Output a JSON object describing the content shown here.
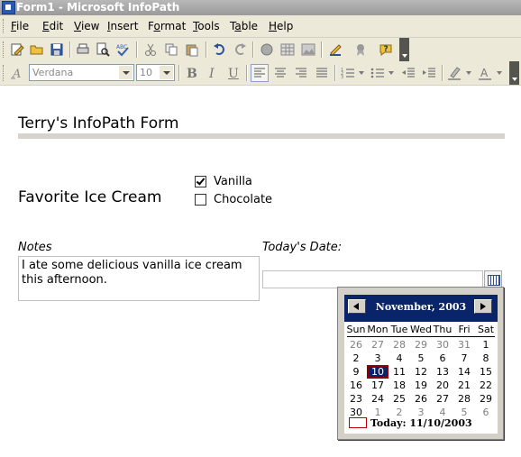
{
  "window": {
    "title": "Form1 - Microsoft InfoPath"
  },
  "menu": [
    {
      "label": "File",
      "mnemonic": "F"
    },
    {
      "label": "Edit",
      "mnemonic": "E"
    },
    {
      "label": "View",
      "mnemonic": "V"
    },
    {
      "label": "Insert",
      "mnemonic": "I"
    },
    {
      "label": "Format",
      "mnemonic": "o"
    },
    {
      "label": "Tools",
      "mnemonic": "T"
    },
    {
      "label": "Table",
      "mnemonic": "a"
    },
    {
      "label": "Help",
      "mnemonic": "H"
    }
  ],
  "format_toolbar": {
    "font_name": "Verdana",
    "font_size": "10",
    "bold": "B",
    "italic": "I",
    "underline": "U"
  },
  "form": {
    "title": "Terry's InfoPath Form",
    "favorite_label": "Favorite Ice Cream",
    "options": [
      {
        "label": "Vanilla",
        "checked": true
      },
      {
        "label": "Chocolate",
        "checked": false
      }
    ],
    "notes_label": "Notes",
    "notes_value": "I ate some delicious vanilla ice cream this afternoon.",
    "date_label": "Today's Date:",
    "date_value": ""
  },
  "calendar": {
    "month_label": "November, 2003",
    "weekdays": [
      "Sun",
      "Mon",
      "Tue",
      "Wed",
      "Thu",
      "Fri",
      "Sat"
    ],
    "weeks": [
      [
        "26",
        "27",
        "28",
        "29",
        "30",
        "31",
        "1"
      ],
      [
        "2",
        "3",
        "4",
        "5",
        "6",
        "7",
        "8"
      ],
      [
        "9",
        "10",
        "11",
        "12",
        "13",
        "14",
        "15"
      ],
      [
        "16",
        "17",
        "18",
        "19",
        "20",
        "21",
        "22"
      ],
      [
        "23",
        "24",
        "25",
        "26",
        "27",
        "28",
        "29"
      ],
      [
        "30",
        "1",
        "2",
        "3",
        "4",
        "5",
        "6"
      ]
    ],
    "selected_day": "10",
    "today_text": "Today: 11/10/2003"
  },
  "colors": {
    "calendar_header": "#0a246a",
    "toolbar_bg": "#ece9d8",
    "selected_border": "#8b0000"
  }
}
